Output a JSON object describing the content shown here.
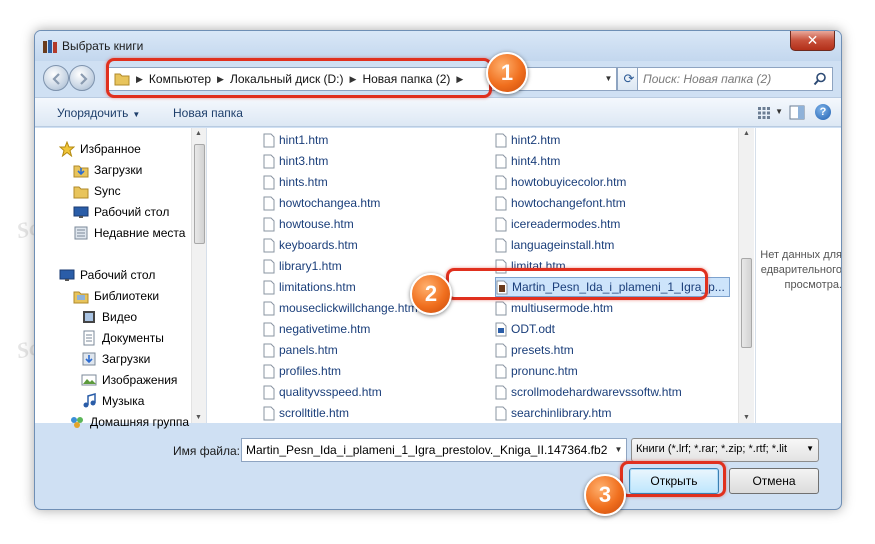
{
  "window": {
    "title": "Выбрать книги",
    "close_glyph": "✕"
  },
  "address": {
    "crumbs": [
      "Компьютер",
      "Локальный диск (D:)",
      "Новая папка (2)"
    ],
    "search_placeholder": "Поиск: Новая папка (2)"
  },
  "toolbar": {
    "organize": "Упорядочить",
    "new_folder": "Новая папка",
    "help": "?"
  },
  "nav": {
    "items": [
      {
        "label": "Избранное",
        "icon": "star-icon"
      },
      {
        "label": "Загрузки",
        "icon": "downloads-folder-icon"
      },
      {
        "label": "Sync",
        "icon": "folder-icon"
      },
      {
        "label": "Рабочий стол",
        "icon": "desktop-icon"
      },
      {
        "label": "Недавние места",
        "icon": "recent-places-icon"
      },
      {
        "label": "Рабочий стол",
        "icon": "desktop-icon"
      },
      {
        "label": "Библиотеки",
        "icon": "libraries-icon"
      },
      {
        "label": "Видео",
        "icon": "video-icon"
      },
      {
        "label": "Документы",
        "icon": "documents-icon"
      },
      {
        "label": "Загрузки",
        "icon": "downloads-icon"
      },
      {
        "label": "Изображения",
        "icon": "pictures-icon"
      },
      {
        "label": "Музыка",
        "icon": "music-icon"
      },
      {
        "label": "Домашняя группа",
        "icon": "homegroup-icon"
      }
    ]
  },
  "files": {
    "col1": [
      "hint1.htm",
      "hint3.htm",
      "hints.htm",
      "howtochangea.htm",
      "howtouse.htm",
      "keyboards.htm",
      "library1.htm",
      "limitations.htm",
      "mouseclickwillchange.htm",
      "negativetime.htm",
      "panels.htm",
      "profiles.htm",
      "qualityvsspeed.htm",
      "scrolltitle.htm"
    ],
    "col2": [
      "hint2.htm",
      "hint4.htm",
      "howtobuyicecolor.htm",
      "howtochangefont.htm",
      "icereadermodes.htm",
      "languageinstall.htm",
      "limitat.htm",
      "Martin_Pesn_Ida_i_plameni_1_Igra_p...",
      "multiusermode.htm",
      "ODT.odt",
      "presets.htm",
      "pronunc.htm",
      "scrollmodehardwarevssoftw.htm",
      "searchinlibrary.htm"
    ]
  },
  "preview": {
    "text": "Нет данных для едварительного просмотра."
  },
  "bottom": {
    "filename_label": "Имя файла:",
    "filename_value": "Martin_Pesn_Ida_i_plameni_1_Igra_prestolov._Kniga_II.147364.fb2",
    "filetype": "Книги (*.lrf; *.rar; *.zip; *.rtf; *.lit",
    "open": "Открыть",
    "cancel": "Отмена"
  },
  "callouts": [
    "1",
    "2",
    "3"
  ],
  "watermark": "Soringpcrepair.com",
  "colors": {
    "accent": "#e0301e",
    "badge": "#f06f1e",
    "link": "#1a3e7a"
  }
}
